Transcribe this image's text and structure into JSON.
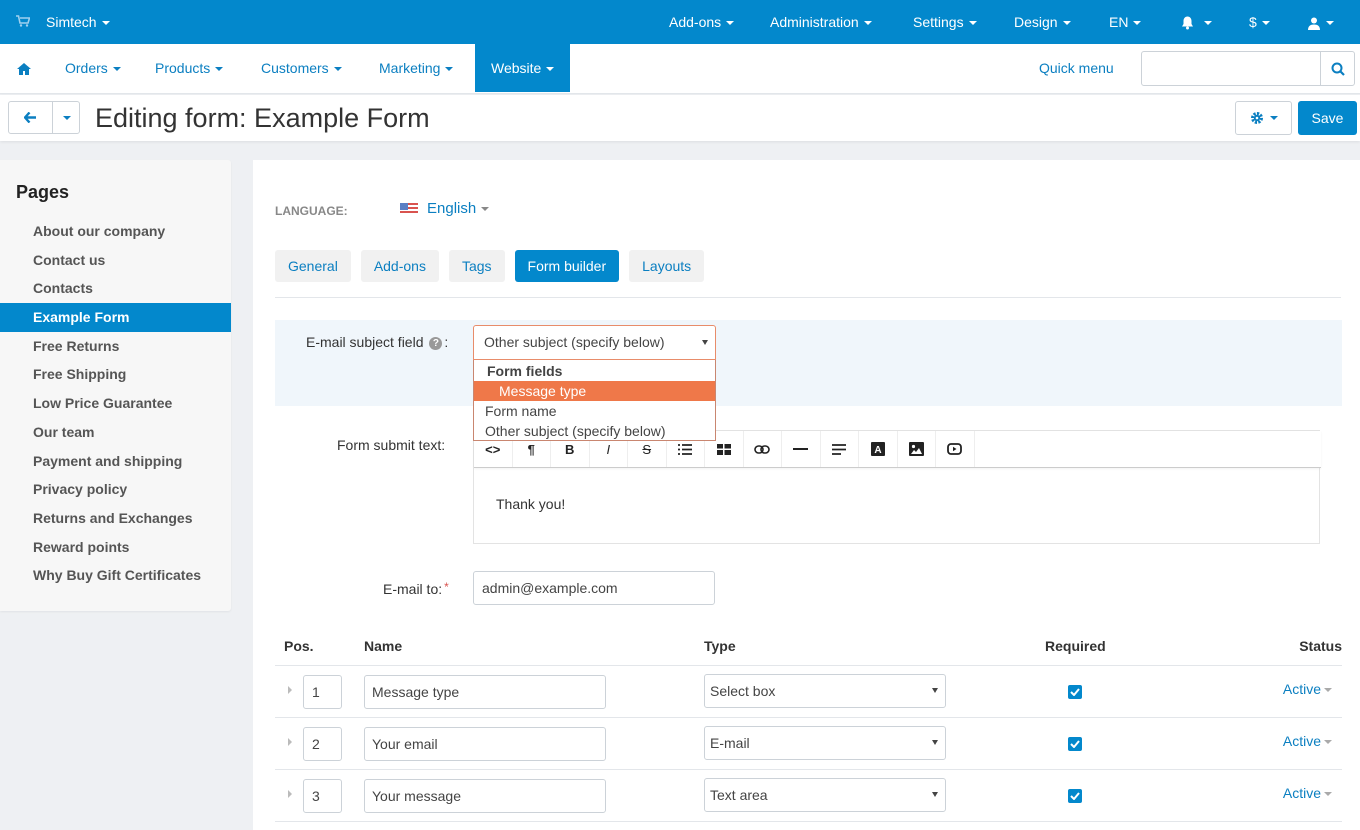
{
  "topbar": {
    "store": "Simtech",
    "menus": [
      "Add-ons",
      "Administration",
      "Settings",
      "Design",
      "EN"
    ],
    "currency": "$"
  },
  "navbar": {
    "items": [
      "Orders",
      "Products",
      "Customers",
      "Marketing",
      "Website"
    ],
    "active": "Website",
    "quick_menu": "Quick menu",
    "search_placeholder": ""
  },
  "titlebar": {
    "title": "Editing form: Example Form",
    "save_label": "Save"
  },
  "sidebar": {
    "heading": "Pages",
    "items": [
      "About our company",
      "Contact us",
      "Contacts",
      "Example Form",
      "Free Returns",
      "Free Shipping",
      "Low Price Guarantee",
      "Our team",
      "Payment and shipping",
      "Privacy policy",
      "Returns and Exchanges",
      "Reward points",
      "Why Buy Gift Certificates"
    ],
    "active": "Example Form"
  },
  "main": {
    "language_label": "LANGUAGE:",
    "language": "English",
    "tabs": [
      "General",
      "Add-ons",
      "Tags",
      "Form builder",
      "Layouts"
    ],
    "active_tab": "Form builder",
    "subject_label": "E-mail subject field",
    "subject_value": "Other subject (specify below)",
    "subject_options": {
      "group": "Form fields",
      "group_items": [
        "Message type"
      ],
      "highlighted": "Message type",
      "others": [
        "Form name",
        "Other subject (specify below)"
      ]
    },
    "submit_text_label": "Form submit text:",
    "submit_text": "Thank you!",
    "editor_toolbar": [
      "code",
      "paragraph",
      "bold",
      "italic",
      "strikethrough",
      "list",
      "table",
      "link",
      "horizontal-rule",
      "align",
      "font-color",
      "image",
      "video"
    ],
    "email_label": "E-mail to:",
    "email_value": "admin@example.com",
    "table": {
      "headers": {
        "pos": "Pos.",
        "name": "Name",
        "type": "Type",
        "required": "Required",
        "status": "Status"
      },
      "rows": [
        {
          "pos": "1",
          "name": "Message type",
          "type": "Select box",
          "required": true,
          "status": "Active"
        },
        {
          "pos": "2",
          "name": "Your email",
          "type": "E-mail",
          "required": true,
          "status": "Active"
        },
        {
          "pos": "3",
          "name": "Your message",
          "type": "Text area",
          "required": true,
          "status": "Active"
        }
      ]
    }
  },
  "colors": {
    "primary": "#0388cc",
    "highlight": "#ef7849",
    "link": "#0b7fc1"
  }
}
